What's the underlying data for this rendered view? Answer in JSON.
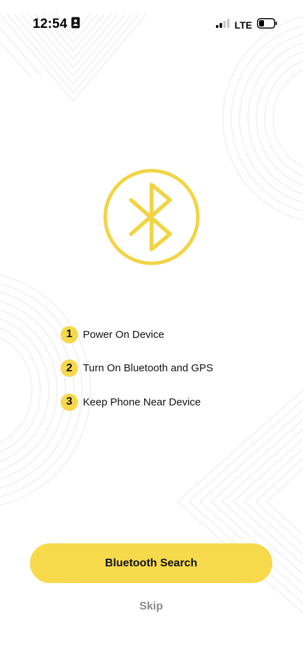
{
  "status_bar": {
    "time": "12:54",
    "network": "LTE"
  },
  "bluetooth_emblem": {
    "icon": "bluetooth-icon",
    "color": "#F2D443"
  },
  "steps": [
    {
      "number": "1",
      "label": "Power On Device"
    },
    {
      "number": "2",
      "label": "Turn On Bluetooth and GPS"
    },
    {
      "number": "3",
      "label": "Keep Phone Near Device"
    }
  ],
  "actions": {
    "primary_label": "Bluetooth Search",
    "skip_label": "Skip"
  },
  "colors": {
    "accent": "#F6DA4C",
    "text": "#111111",
    "muted": "#8A8A8A",
    "background": "#FFFFFF"
  }
}
